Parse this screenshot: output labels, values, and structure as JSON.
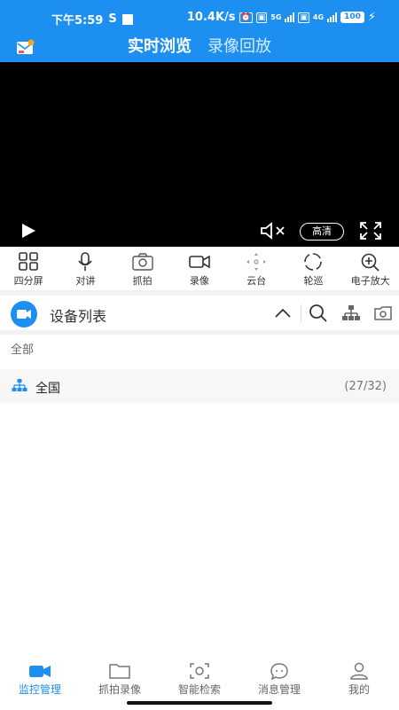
{
  "status_bar": {
    "time": "下午5:59",
    "s_icon": "S",
    "speed": "10.4K/s",
    "network_5g": "5G",
    "network_4g": "4G",
    "battery": "100"
  },
  "header": {
    "tabs": [
      {
        "label": "实时浏览",
        "active": true
      },
      {
        "label": "录像回放",
        "active": false
      }
    ]
  },
  "video": {
    "quality_label": "高清"
  },
  "toolbar": {
    "items": [
      {
        "label": "四分屏",
        "icon": "grid-four-icon"
      },
      {
        "label": "对讲",
        "icon": "microphone-icon"
      },
      {
        "label": "抓拍",
        "icon": "camera-icon"
      },
      {
        "label": "录像",
        "icon": "video-camera-icon"
      },
      {
        "label": "云台",
        "icon": "ptz-icon"
      },
      {
        "label": "轮巡",
        "icon": "patrol-icon"
      },
      {
        "label": "电子放大",
        "icon": "zoom-in-icon"
      }
    ]
  },
  "device_list": {
    "title": "设备列表",
    "filter_label": "全部",
    "groups": [
      {
        "name": "全国",
        "count": "(27/32)"
      }
    ]
  },
  "bottom_nav": {
    "items": [
      {
        "label": "监控管理",
        "active": true
      },
      {
        "label": "抓拍录像",
        "active": false
      },
      {
        "label": "智能检索",
        "active": false
      },
      {
        "label": "消息管理",
        "active": false
      },
      {
        "label": "我的",
        "active": false
      }
    ]
  },
  "colors": {
    "primary": "#1d8ff0",
    "video_bg": "#000000"
  }
}
